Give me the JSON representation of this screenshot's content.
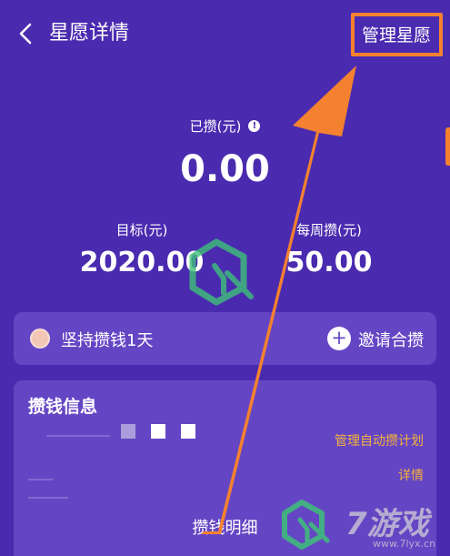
{
  "header": {
    "title": "星愿详情",
    "manage_label": "管理星愿"
  },
  "summary": {
    "saved_label": "已攒(元)",
    "saved_value": "0.00",
    "goal_label": "目标(元)",
    "goal_value": "2020.00",
    "weekly_label": "每周攒(元)",
    "weekly_value": "50.00"
  },
  "streak": {
    "text": "坚持攒钱1天",
    "invite_label": "邀请合攒"
  },
  "savings_info": {
    "title": "攒钱信息",
    "manage_plan_label": "管理自动攒计划",
    "detail_label": "详情",
    "ledger_label": "攒钱明细"
  },
  "watermark": {
    "text": "7游戏",
    "site": "www.7lyx.cn"
  },
  "colors": {
    "background": "#4a2bb0",
    "card": "#6446c4",
    "highlight": "#f4812f",
    "link": "#f5b23a"
  }
}
